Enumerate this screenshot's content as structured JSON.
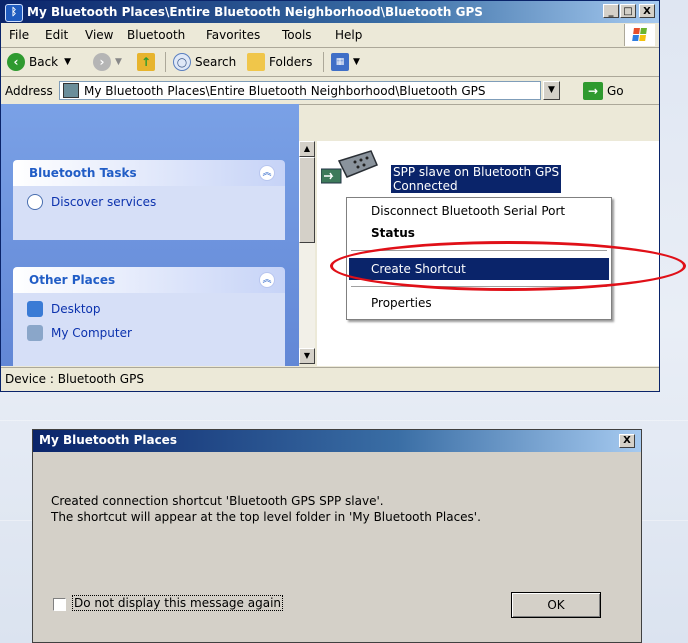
{
  "explorer": {
    "title": "My Bluetooth Places\\Entire Bluetooth Neighborhood\\Bluetooth GPS",
    "caption_buttons": {
      "minimize": "_",
      "maximize": "□",
      "close": "X"
    },
    "menu": [
      "File",
      "Edit",
      "View",
      "Bluetooth",
      "Favorites",
      "Tools",
      "Help"
    ],
    "toolbar": {
      "back": "Back",
      "search": "Search",
      "folders": "Folders"
    },
    "address": {
      "label": "Address",
      "value": "My Bluetooth Places\\Entire Bluetooth Neighborhood\\Bluetooth GPS",
      "go": "Go"
    },
    "tasks": {
      "bluetooth_tasks": {
        "title": "Bluetooth Tasks",
        "items": [
          "Discover services"
        ]
      },
      "other_places": {
        "title": "Other Places",
        "items": [
          "Desktop",
          "My Computer"
        ]
      }
    },
    "device": {
      "name": "SPP slave on Bluetooth GPS",
      "status": "Connected"
    },
    "context_menu": {
      "items": [
        "Disconnect Bluetooth Serial Port",
        "Status",
        "Create Shortcut",
        "Properties"
      ],
      "selected": "Create Shortcut"
    },
    "statusbar": "Device : Bluetooth GPS"
  },
  "dialog": {
    "title": "My Bluetooth Places",
    "line1": "Created connection shortcut 'Bluetooth GPS SPP slave'.",
    "line2": "The shortcut will appear at the top level folder in 'My Bluetooth Places'.",
    "checkbox_label": "Do not display this message again",
    "checkbox_checked": false,
    "ok": "OK"
  },
  "colors": {
    "highlight": "#0a246a",
    "annotation": "#e01018",
    "task_pane": "#6b8ee0"
  }
}
